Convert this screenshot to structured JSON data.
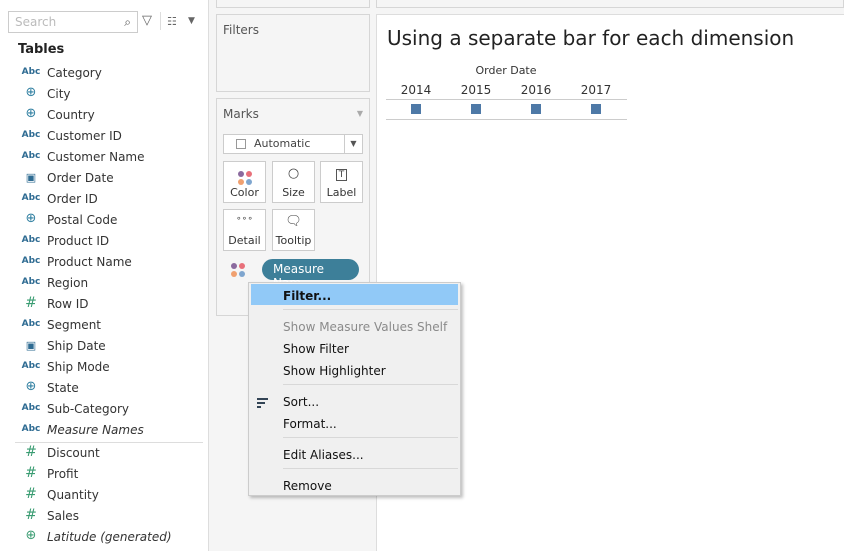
{
  "sidebar": {
    "search_placeholder": "Search",
    "tables_label": "Tables",
    "fields": [
      {
        "type": "abc",
        "label": "Category",
        "italic": false
      },
      {
        "type": "globe",
        "label": "City",
        "italic": false
      },
      {
        "type": "globe",
        "label": "Country",
        "italic": false
      },
      {
        "type": "abc",
        "label": "Customer ID",
        "italic": false
      },
      {
        "type": "abc",
        "label": "Customer Name",
        "italic": false
      },
      {
        "type": "date",
        "label": "Order Date",
        "italic": false
      },
      {
        "type": "abc",
        "label": "Order ID",
        "italic": false
      },
      {
        "type": "globe",
        "label": "Postal Code",
        "italic": false
      },
      {
        "type": "abc",
        "label": "Product ID",
        "italic": false
      },
      {
        "type": "abc",
        "label": "Product Name",
        "italic": false
      },
      {
        "type": "abc",
        "label": "Region",
        "italic": false
      },
      {
        "type": "hash",
        "label": "Row ID",
        "italic": false
      },
      {
        "type": "abc",
        "label": "Segment",
        "italic": false
      },
      {
        "type": "date",
        "label": "Ship Date",
        "italic": false
      },
      {
        "type": "abc",
        "label": "Ship Mode",
        "italic": false
      },
      {
        "type": "globe",
        "label": "State",
        "italic": false
      },
      {
        "type": "abc",
        "label": "Sub-Category",
        "italic": false
      },
      {
        "type": "abc",
        "label": "Measure Names",
        "italic": true
      }
    ],
    "measures": [
      {
        "type": "hash",
        "label": "Discount",
        "italic": false
      },
      {
        "type": "hash",
        "label": "Profit",
        "italic": false
      },
      {
        "type": "hash",
        "label": "Quantity",
        "italic": false
      },
      {
        "type": "hash",
        "label": "Sales",
        "italic": false
      },
      {
        "type": "globe-measure",
        "label": "Latitude (generated)",
        "italic": true
      }
    ]
  },
  "filters": {
    "title": "Filters"
  },
  "marks": {
    "title": "Marks",
    "mark_type": "Automatic",
    "cards": {
      "color": "Color",
      "size": "Size",
      "label": "Label",
      "detail": "Detail",
      "tooltip": "Tooltip"
    },
    "pill": "Measure Nam..",
    "palette": [
      "#8b6a9e",
      "#e8707a",
      "#f0a070",
      "#7fa6cf"
    ]
  },
  "view": {
    "title": "Using a separate bar for each dimension",
    "column_header": "Order Date",
    "years": [
      "2014",
      "2015",
      "2016",
      "2017"
    ],
    "mark_color": "#4e79a7"
  },
  "context_menu": {
    "items": [
      {
        "label": "Filter...",
        "highlighted": true,
        "disabled": false
      },
      {
        "label": "Show Measure Values Shelf",
        "disabled": true
      },
      {
        "label": "Show Filter",
        "disabled": false
      },
      {
        "label": "Show Highlighter",
        "disabled": false
      },
      {
        "label": "Sort...",
        "disabled": false,
        "icon": "sort-icon"
      },
      {
        "label": "Format...",
        "disabled": false
      },
      {
        "label": "Edit Aliases...",
        "disabled": false
      },
      {
        "label": "Remove",
        "disabled": false
      }
    ]
  }
}
